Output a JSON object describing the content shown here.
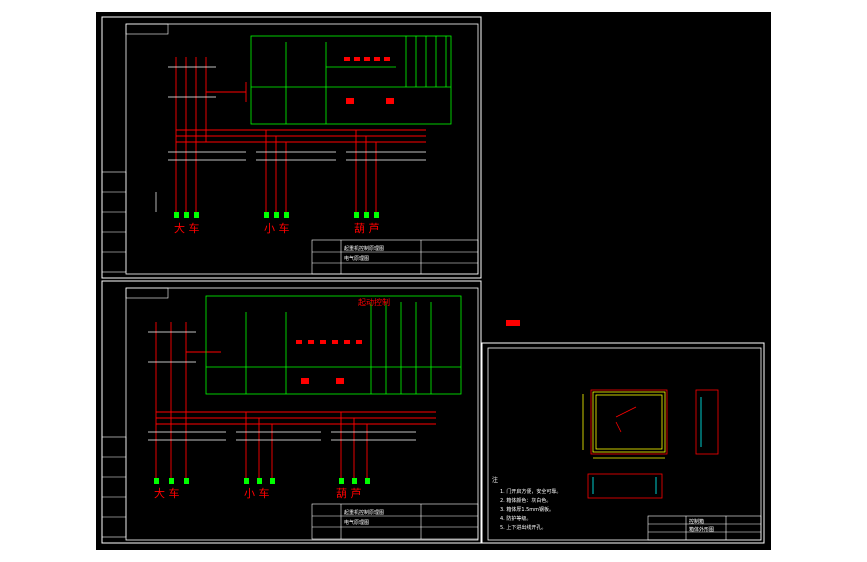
{
  "drawings": {
    "top": {
      "labels": {
        "crane": "大 车",
        "trolley": "小 车",
        "hoist": "葫 芦"
      },
      "title_block": {
        "name": "起重机控制原理图",
        "sub": "电气原理图"
      }
    },
    "bottom": {
      "labels": {
        "crane": "大 车",
        "trolley": "小 车",
        "hoist": "葫 芦"
      },
      "header_red": "起动控制",
      "title_block": {
        "name": "起重机控制原理图",
        "sub": "电气原理图"
      }
    },
    "panel": {
      "notes_title": "注",
      "notes": [
        "1. 门开启方便，安全可靠。",
        "2. 箱体颜色：灰白色。",
        "3. 箱体厚1.5mm钢板。",
        "4. 防护等级。",
        "5. 上下进出线开孔。"
      ],
      "title_block": {
        "name": "控制箱",
        "sub": "箱体外形图"
      }
    }
  },
  "colors": {
    "background": "#000000",
    "frame": "#ffffff",
    "green": "#00ff00",
    "red": "#ff0000",
    "yellow": "#ffff00",
    "magenta": "#ff00ff"
  }
}
